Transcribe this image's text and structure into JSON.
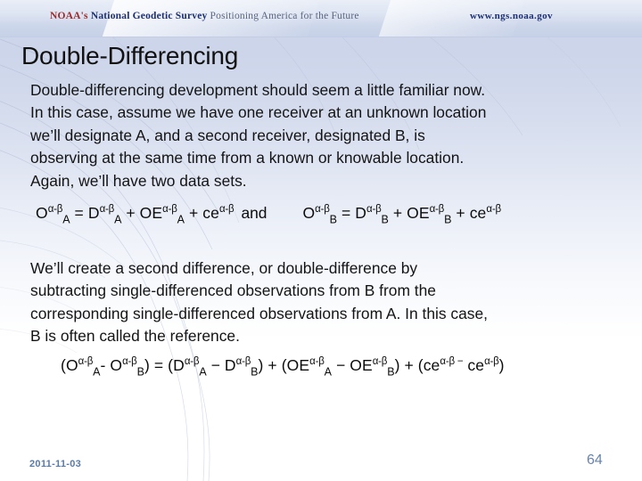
{
  "header": {
    "noaa_prefix": "NOAA's ",
    "agency": "National Geodetic Survey",
    "tagline": " Positioning America for the Future",
    "url": "www.ngs.noaa.gov"
  },
  "title": "Double-Differencing",
  "paragraph_1": [
    "Double-differencing development should seem a little familiar now.",
    "In this case, assume we have one receiver at an unknown location",
    "we’ll designate A, and a second receiver, designated B, is",
    "observing at the same time from a known or knowable location.",
    "Again, we’ll have two data sets."
  ],
  "equation_1": {
    "left": {
      "o": "O",
      "o_sup": "α-β",
      "o_sub": "A",
      "eq": " = ",
      "d": "D",
      "d_sup": "α-β",
      "d_sub": "A",
      "plus1": " + ",
      "oe": "OE",
      "oe_sup": "α-β",
      "oe_sub": "A",
      "plus2": " + ",
      "ce": "ce",
      "ce_sup": "α-β"
    },
    "conjunction": "and",
    "right": {
      "o": "O",
      "o_sup": "α-β",
      "o_sub": "B",
      "eq": " = ",
      "d": "D",
      "d_sup": "α-β",
      "d_sub": "B",
      "plus1": " + ",
      "oe": "OE",
      "oe_sup": "α-β",
      "oe_sub": "B",
      "plus2": " + ",
      "ce": "ce",
      "ce_sup": "α-β"
    }
  },
  "paragraph_2": [
    "We’ll create a second difference, or double-difference by",
    "subtracting single-differenced observations from B from the",
    "corresponding single-differenced observations from A. In this case,",
    "B is often called the reference."
  ],
  "equation_2": {
    "open1": "(",
    "o_a": "O",
    "o_a_sup": "α-β",
    "o_a_sub": "A",
    "minus1": "- ",
    "o_b": "O",
    "o_b_sup": "α-β",
    "o_b_sub": "B",
    "close1": ")",
    "equals": " = ",
    "open2": "(",
    "d_a": "D",
    "d_a_sup": "α-β",
    "d_a_sub": "A",
    "minus2": " − ",
    "d_b": "D",
    "d_b_sup": "α-β",
    "d_b_sub": "B",
    "close2": ")",
    "plus1": " + ",
    "open3": "(",
    "oe_a": "OE",
    "oe_a_sup": "α-β",
    "oe_a_sub": "A",
    "minus3": " − ",
    "oe_b": "OE",
    "oe_b_sup": "α-β",
    "oe_b_sub": "B",
    "close3": ")",
    "plus2": " + ",
    "open4": "(",
    "ce_a": "ce",
    "ce_a_sup": "α-β −",
    "ce_b": " ce",
    "ce_b_sup": "α-β",
    "close4": ")"
  },
  "footer": {
    "date": "2011-11-03",
    "page": "64"
  },
  "colors": {
    "bg_top": "#ccd5ea",
    "bg_bottom": "#ffffff",
    "noaa_red": "#9f2a2a",
    "ngs_blue": "#1c2f72",
    "footer_blue": "#5a7aa8",
    "text": "#141414"
  }
}
